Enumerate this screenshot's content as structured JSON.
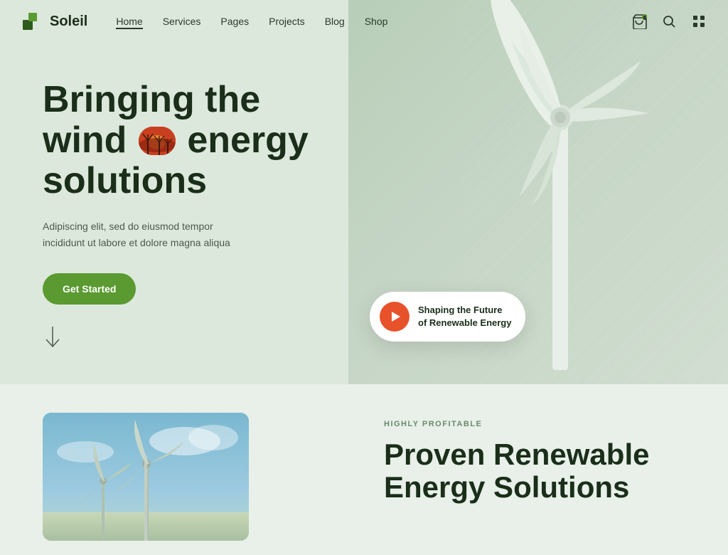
{
  "header": {
    "logo_text": "Soleil",
    "nav_items": [
      {
        "label": "Home",
        "active": true
      },
      {
        "label": "Services",
        "active": false
      },
      {
        "label": "Pages",
        "active": false
      },
      {
        "label": "Projects",
        "active": false
      },
      {
        "label": "Blog",
        "active": false
      },
      {
        "label": "Shop",
        "active": false
      }
    ],
    "icons": [
      "cart-icon",
      "search-icon",
      "grid-icon"
    ]
  },
  "hero": {
    "title_line1": "Bringing the",
    "title_line2": "wind",
    "title_line3": "energy",
    "title_line4": "solutions",
    "subtitle": "Adipiscing elit, sed do eiusmod tempor incididunt ut labore et dolore magna aliqua",
    "cta_label": "Get Started",
    "play_card_text": "Shaping the Future\nof Renewable Energy"
  },
  "bottom": {
    "tag": "HIGHLY PROFITABLE",
    "title_line1": "Proven Renewable",
    "title_line2": "Energy Solutions"
  },
  "colors": {
    "accent_green": "#5a9a30",
    "accent_orange": "#e8522a",
    "text_dark": "#1a2e1a",
    "bg_light": "#e8f0e9"
  }
}
